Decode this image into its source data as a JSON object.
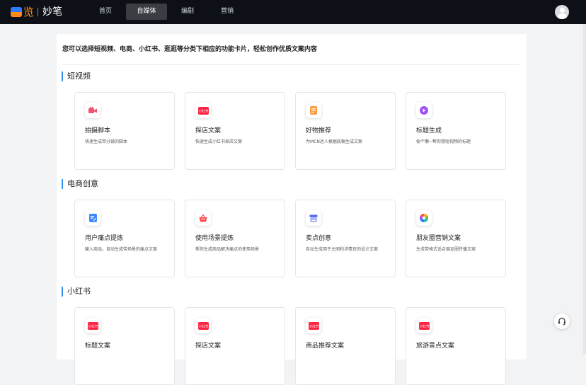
{
  "brand": {
    "mark": "览",
    "name": "妙笔"
  },
  "nav": [
    {
      "label": "首页",
      "active": false
    },
    {
      "label": "自媒体",
      "active": true
    },
    {
      "label": "编剧",
      "active": false
    },
    {
      "label": "营销",
      "active": false
    }
  ],
  "page": {
    "description": "您可以选择短视频、电商、小红书、逛逛等分类下相应的功能卡片，轻松创作优质文案内容"
  },
  "sections": [
    {
      "title": "短视频",
      "cards": [
        {
          "title": "拍摄脚本",
          "desc": "快速生成带分镜的脚本",
          "icon": "video-camera-icon",
          "color": "#f0546e"
        },
        {
          "title": "探店文案",
          "desc": "快速生成小红书探店文案",
          "icon": "xiaohongshu-icon",
          "color": "#ff2442"
        },
        {
          "title": "好物推荐",
          "desc": "为MCN达人根据底稿生成文案",
          "icon": "document-icon",
          "color": "#ff9a3c"
        },
        {
          "title": "标题生成",
          "desc": "偷个懒~帮你想短视频的标题",
          "icon": "play-circle-icon",
          "color": "#a052f5"
        }
      ]
    },
    {
      "title": "电商创意",
      "cards": [
        {
          "title": "用户痛点提炼",
          "desc": "输入商品，自动生成带场景的痛点文案",
          "icon": "edit-note-icon",
          "color": "#3d8bff"
        },
        {
          "title": "使用场景提炼",
          "desc": "帮你生成商品解决痛点的使用场景",
          "icon": "shopping-basket-icon",
          "color": "#ff4d4f"
        },
        {
          "title": "卖点创意",
          "desc": "自动生成用于主图和详情页的设计文案",
          "icon": "storefront-icon",
          "color": "#5b6cf0"
        },
        {
          "title": "朋友圈营销文案",
          "desc": "生成带格式适合朋友圈传播文案",
          "icon": "shutter-icon",
          "color": "#f5a623"
        }
      ]
    },
    {
      "title": "小红书",
      "cards": [
        {
          "title": "标题文案",
          "desc": "",
          "icon": "xiaohongshu-icon",
          "color": "#ff2442"
        },
        {
          "title": "探店文案",
          "desc": "",
          "icon": "xiaohongshu-icon",
          "color": "#ff2442"
        },
        {
          "title": "商品推荐文案",
          "desc": "",
          "icon": "xiaohongshu-icon",
          "color": "#ff2442"
        },
        {
          "title": "旅游景点文案",
          "desc": "",
          "icon": "xiaohongshu-icon",
          "color": "#ff2442"
        }
      ]
    }
  ],
  "icons": {
    "xiaohongshu_text": "小红书"
  },
  "avatar_icon": "user-icon",
  "support_icon": "headset-icon"
}
